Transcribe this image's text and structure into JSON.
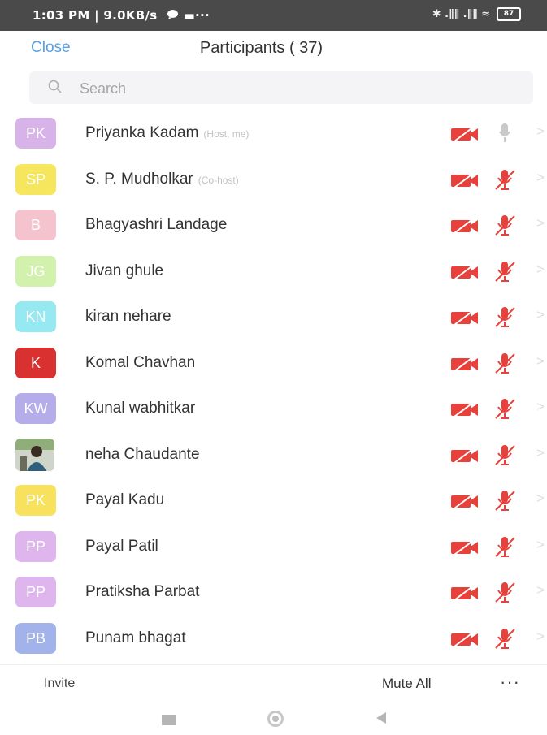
{
  "status_bar": {
    "time_speed": "1:03 PM | 9.0KB/s",
    "chat_icon": "chat-bubble-icon",
    "dots": "▬···",
    "signals": "✱ .∥∥ .∥∥ ≈",
    "battery": "87"
  },
  "header": {
    "close_label": "Close",
    "title": "Participants ( 37)"
  },
  "search": {
    "placeholder": "Search"
  },
  "participants": [
    {
      "initials": "PK",
      "name": "Priyanka Kadam",
      "tag": "(Host, me)",
      "color": "#cfa3e6",
      "mic": "unmuted"
    },
    {
      "initials": "SP",
      "name": "S. P. Mudholkar",
      "tag": "(Co-host)",
      "color": "#f5e13a",
      "mic": "muted"
    },
    {
      "initials": "B",
      "name": "Bhagyashri  Landage",
      "tag": "",
      "color": "#f3b7c4",
      "mic": "muted"
    },
    {
      "initials": "JG",
      "name": "Jivan ghule",
      "tag": "",
      "color": "#c9ee9c",
      "mic": "muted"
    },
    {
      "initials": "KN",
      "name": "kiran nehare",
      "tag": "",
      "color": "#7fe3ef",
      "mic": "muted"
    },
    {
      "initials": "K",
      "name": "Komal Chavhan",
      "tag": "",
      "color": "#d9312f",
      "mic": "muted"
    },
    {
      "initials": "KW",
      "name": "Kunal wabhitkar",
      "tag": "",
      "color": "#a59be6",
      "mic": "muted"
    },
    {
      "initials": "",
      "name": "neha Chaudante",
      "tag": "",
      "color": "#7b8a6a",
      "mic": "muted",
      "photo": true
    },
    {
      "initials": "PK",
      "name": "Payal Kadu",
      "tag": "",
      "color": "#f7dc3a",
      "mic": "muted"
    },
    {
      "initials": "PP",
      "name": "Payal Patil",
      "tag": "",
      "color": "#d7a5ea",
      "mic": "muted"
    },
    {
      "initials": "PP",
      "name": "Pratiksha Parbat",
      "tag": "",
      "color": "#d7a5ea",
      "mic": "muted"
    },
    {
      "initials": "PB",
      "name": "Punam bhagat",
      "tag": "",
      "color": "#8ea2e6",
      "mic": "muted"
    }
  ],
  "bottom_bar": {
    "invite_label": "Invite",
    "mute_all_label": "Mute All",
    "more_label": "···"
  },
  "colors": {
    "accent": "#5aa0e0",
    "video_off": "#e8403a",
    "mic_muted": "#e8403a"
  }
}
